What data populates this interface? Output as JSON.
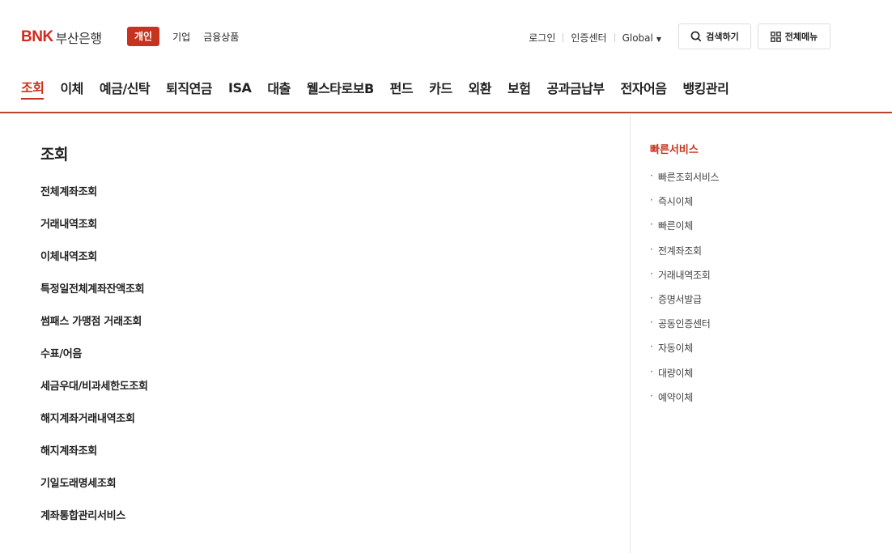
{
  "logo": {
    "mark": "BNK",
    "name": "부산은행"
  },
  "segment": {
    "active": "개인",
    "items": [
      "기업",
      "금융상품"
    ]
  },
  "util": {
    "login": "로그인",
    "cert": "인증센터",
    "global": "Global"
  },
  "buttons": {
    "search": "검색하기",
    "all_menu": "전체메뉴"
  },
  "gnb": [
    "조회",
    "이체",
    "예금/신탁",
    "퇴직연금",
    "ISA",
    "대출",
    "웰스타로보B",
    "펀드",
    "카드",
    "외환",
    "보험",
    "공과금납부",
    "전자어음",
    "뱅킹관리"
  ],
  "panel": {
    "title": "조회",
    "items": [
      "전체계좌조회",
      "거래내역조회",
      "이체내역조회",
      "특정일전체계좌잔액조회",
      "썸패스 가맹점 거래조회",
      "수표/어음",
      "세금우대/비과세한도조회",
      "해지계좌거래내역조회",
      "해지계좌조회",
      "기일도래명세조회",
      "계좌통합관리서비스"
    ]
  },
  "quick": {
    "title": "빠른서비스",
    "items": [
      "빠른조회서비스",
      "즉시이체",
      "빠른이체",
      "전계좌조회",
      "거래내역조회",
      "증명서발급",
      "공동인증센터",
      "자동이체",
      "대량이체",
      "예약이체"
    ]
  },
  "icons": {
    "search": "search-icon",
    "grid": "grid-icon",
    "caret": "caret-down-icon"
  },
  "colors": {
    "brand": "#c8331e",
    "logo": "#d22a1f"
  }
}
